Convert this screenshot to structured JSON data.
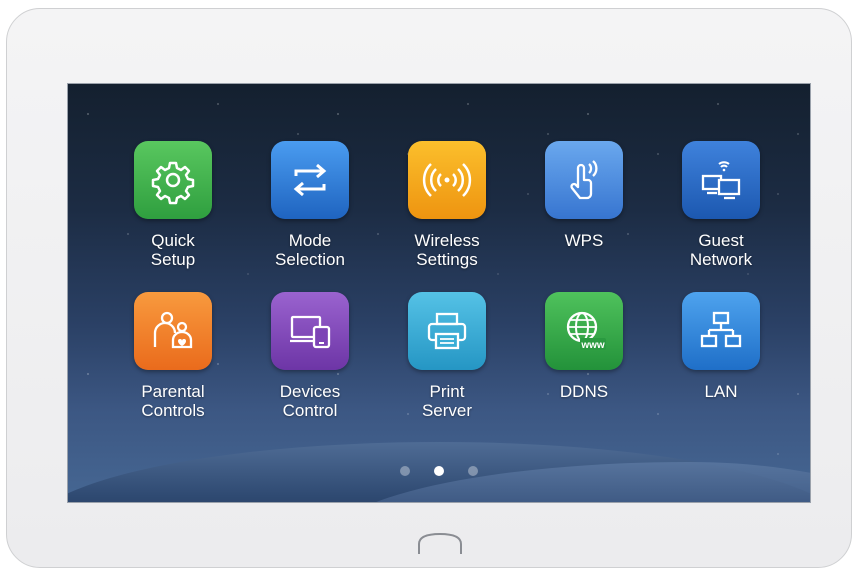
{
  "apps": [
    {
      "label": "Quick\nSetup",
      "icon": "gear-icon",
      "color": "#3db34a"
    },
    {
      "label": "Mode\nSelection",
      "icon": "swap-arrows-icon",
      "color": "#2f7fd8"
    },
    {
      "label": "Wireless\nSettings",
      "icon": "wireless-signal-icon",
      "color": "#f4a81c"
    },
    {
      "label": "WPS",
      "icon": "touch-wps-icon",
      "color": "#4a8de0"
    },
    {
      "label": "Guest\nNetwork",
      "icon": "guest-network-icon",
      "color": "#2a6bc4"
    },
    {
      "label": "Parental\nControls",
      "icon": "parental-icon",
      "color": "#f07b26"
    },
    {
      "label": "Devices\nControl",
      "icon": "devices-icon",
      "color": "#8048b8"
    },
    {
      "label": "Print\nServer",
      "icon": "printer-icon",
      "color": "#3aaed6"
    },
    {
      "label": "DDNS",
      "icon": "globe-www-icon",
      "color": "#33a845"
    },
    {
      "label": "LAN",
      "icon": "lan-network-icon",
      "color": "#2e86d9"
    }
  ],
  "pager": {
    "pages": 3,
    "current": 2
  },
  "home_button_icon": "home-arch-icon"
}
